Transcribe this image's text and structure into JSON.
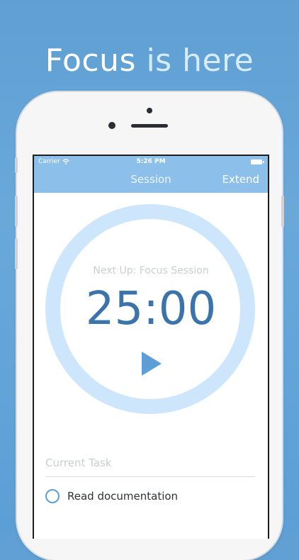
{
  "headline": {
    "word1": "Focus",
    "word2": "is here"
  },
  "status_bar": {
    "carrier": "Carrier",
    "time": "5:26 PM"
  },
  "nav": {
    "title": "Session",
    "action": "Extend"
  },
  "timer": {
    "next_up": "Next Up: Focus Session",
    "time": "25:00"
  },
  "task": {
    "label": "Current Task",
    "items": [
      {
        "text": "Read documentation",
        "done": false
      }
    ]
  },
  "icons": {
    "wifi": "wifi-icon",
    "battery": "battery-icon",
    "play": "play-icon",
    "check": "check-circle-icon"
  },
  "colors": {
    "background": "#5f9fd3",
    "nav": "#8cc0ea",
    "ring": "#cde6fb",
    "timer": "#3a74aa",
    "accent": "#5e9ed6"
  }
}
